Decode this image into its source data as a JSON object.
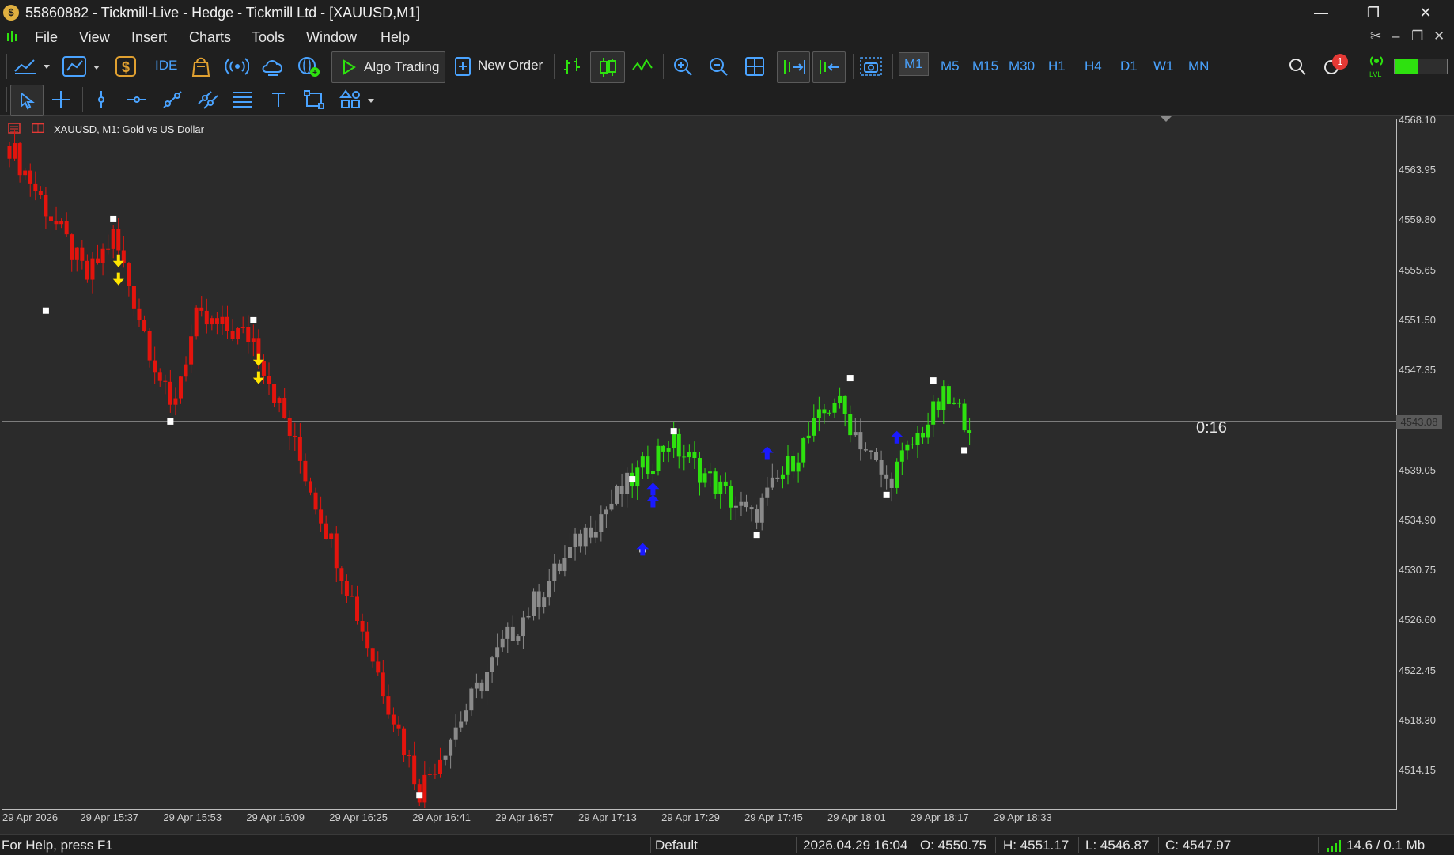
{
  "window": {
    "title": "55860882 - Tickmill-Live - Hedge - Tickmill Ltd - [XAUUSD,M1]",
    "app_icon": "$"
  },
  "menu": [
    "File",
    "View",
    "Insert",
    "Charts",
    "Tools",
    "Window",
    "Help"
  ],
  "toolbar": {
    "ide_label": "IDE",
    "algo_trading_label": "Algo Trading",
    "new_order_label": "New Order",
    "timeframes": [
      "M1",
      "M5",
      "M15",
      "M30",
      "H1",
      "H4",
      "D1",
      "W1",
      "MN"
    ],
    "active_timeframe": "M1",
    "notification_count": "1",
    "lvl_label": "LVL",
    "signal_level": 0.45
  },
  "chart": {
    "label": "XAUUSD, M1:  Gold vs US Dollar",
    "price_labels": [
      "4568.10",
      "4563.95",
      "4559.80",
      "4555.65",
      "4551.50",
      "4547.35",
      "4543.08",
      "4539.05",
      "4534.90",
      "4530.75",
      "4526.60",
      "4522.45",
      "4518.30",
      "4514.15"
    ],
    "current_price": "4543.08",
    "countdown": "0:16",
    "time_labels": [
      "29 Apr 2026",
      "29 Apr 15:37",
      "29 Apr 15:53",
      "29 Apr 16:09",
      "29 Apr 16:25",
      "29 Apr 16:41",
      "29 Apr 16:57",
      "29 Apr 17:13",
      "29 Apr 17:29",
      "29 Apr 17:45",
      "29 Apr 18:01",
      "29 Apr 18:17",
      "29 Apr 18:33"
    ],
    "colors": {
      "bear": "#e3140d",
      "bull": "#2ee10f",
      "neutral": "#8a8a8a",
      "sell_arrow": "#ffe600",
      "buy_arrow": "#1a1aff"
    }
  },
  "chart_data": {
    "type": "candlestick",
    "symbol": "XAUUSD",
    "timeframe": "M1",
    "x_range": [
      "29 Apr 2026 15:22",
      "29 Apr 18:27"
    ],
    "y_range": [
      4511.0,
      4568.1
    ],
    "current_price": 4543.08,
    "close_path": [
      {
        "time": "15:22",
        "price": 4566.0
      },
      {
        "time": "15:37",
        "price": 4555.0
      },
      {
        "time": "15:42",
        "price": 4558.5
      },
      {
        "time": "15:53",
        "price": 4544.0
      },
      {
        "time": "15:58",
        "price": 4551.5
      },
      {
        "time": "16:09",
        "price": 4550.0
      },
      {
        "time": "16:25",
        "price": 4532.0
      },
      {
        "time": "16:41",
        "price": 4512.5
      },
      {
        "time": "16:57",
        "price": 4524.5
      },
      {
        "time": "17:13",
        "price": 4534.0
      },
      {
        "time": "17:29",
        "price": 4541.5
      },
      {
        "time": "17:45",
        "price": 4535.0
      },
      {
        "time": "18:01",
        "price": 4545.0
      },
      {
        "time": "18:11",
        "price": 4538.0
      },
      {
        "time": "18:22",
        "price": 4545.0
      },
      {
        "time": "18:27",
        "price": 4543.08
      }
    ],
    "swing_markers": [
      {
        "time": "15:29",
        "price": 4552.3
      },
      {
        "time": "15:42",
        "price": 4559.9
      },
      {
        "time": "15:53",
        "price": 4543.1
      },
      {
        "time": "16:09",
        "price": 4551.5
      },
      {
        "time": "16:41",
        "price": 4512.1
      },
      {
        "time": "17:22",
        "price": 4538.3
      },
      {
        "time": "17:24",
        "price": 4532.5
      },
      {
        "time": "17:30",
        "price": 4542.3
      },
      {
        "time": "17:46",
        "price": 4533.7
      },
      {
        "time": "18:04",
        "price": 4546.7
      },
      {
        "time": "18:11",
        "price": 4537.0
      },
      {
        "time": "18:20",
        "price": 4546.5
      },
      {
        "time": "18:26",
        "price": 4540.7
      }
    ],
    "sell_signals": [
      {
        "time": "15:43",
        "price": 4556.3
      },
      {
        "time": "15:43",
        "price": 4554.8
      },
      {
        "time": "16:10",
        "price": 4548.1
      },
      {
        "time": "16:10",
        "price": 4546.6
      }
    ],
    "buy_signals": [
      {
        "time": "17:24",
        "price": 4532.5
      },
      {
        "time": "17:26",
        "price": 4536.5
      },
      {
        "time": "17:26",
        "price": 4537.5
      },
      {
        "time": "17:48",
        "price": 4540.5
      },
      {
        "time": "18:13",
        "price": 4541.8
      }
    ]
  },
  "status": {
    "help": "For Help, press F1",
    "profile": "Default",
    "datetime": "2026.04.29 16:04",
    "open": "O: 4550.75",
    "high": "H: 4551.17",
    "low": "L: 4546.87",
    "close": "C: 4547.97",
    "traffic": "14.6 / 0.1 Mb"
  }
}
